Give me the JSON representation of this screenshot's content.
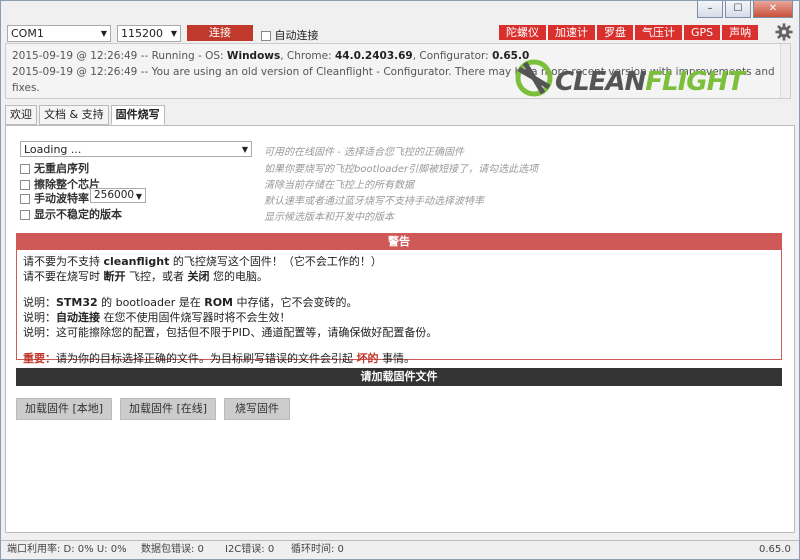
{
  "window_controls": {
    "minimize": "–",
    "maximize": "☐",
    "close": "✕"
  },
  "toolbar": {
    "port": "COM1",
    "baud": "115200",
    "connect_label": "连接",
    "auto_connect_label": "自动连接",
    "sensors": [
      "陀螺仪",
      "加速计",
      "罗盘",
      "气压计",
      "GPS",
      "声呐"
    ]
  },
  "log": {
    "line1": {
      "prefix": "2015-09-19 @ 12:26:49 -- Running - OS: ",
      "os": "Windows",
      "mid": ", Chrome: ",
      "chrome": "44.0.2403.69",
      "mid2": ", Configurator: ",
      "configurator": "0.65.0"
    },
    "line2": "2015-09-19 @ 12:26:49 -- You are using an old version of Cleanflight - Configurator. There may be a more recent version with improvements and fixes."
  },
  "logo": {
    "part1": "CLEAN",
    "part2": "FLIGHT"
  },
  "tabs": [
    "欢迎",
    "文档 & 支持",
    "固件烧写"
  ],
  "firmware": {
    "select_value": "Loading ...",
    "select_desc": "可用的在线固件 - 选择适合您飞控的正确固件",
    "options": [
      {
        "label": "无重启序列",
        "desc": "如果你要烧写的飞控bootloader引脚被短接了，请勾选此选项"
      },
      {
        "label": "擦除整个芯片",
        "desc": "清除当前存储在飞控上的所有数据"
      },
      {
        "label": "手动波特率",
        "desc": "默认速率或者通过蓝牙烧写不支持手动选择波特率"
      },
      {
        "label": "显示不稳定的版本",
        "desc": "显示候选版本和开发中的版本"
      }
    ],
    "baud_value": "256000"
  },
  "warning": {
    "title": "警告",
    "l1a": "请不要为不支持 ",
    "l1b": "cleanflight",
    "l1c": " 的飞控烧写这个固件！（它不会工作的！）",
    "l2a": "请不要在烧写时 ",
    "l2b": "断开",
    "l2c": " 飞控，或者 ",
    "l2d": "关闭",
    "l2e": " 您的电脑。",
    "n1a": "说明：",
    "n1b": "STM32",
    "n1c": " 的 bootloader 是在 ",
    "n1d": "ROM",
    "n1e": " 中存储，它不会变砖的。",
    "n2a": "说明：",
    "n2b": "自动连接",
    "n2c": " 在您不使用固件烧写器时将不会生效！",
    "n3": "说明：这可能擦除您的配置，包括但不限于PID、通道配置等，请确保做好配置备份。",
    "imp_a": "重要：",
    "imp_b": "请为你的目标选择正确的文件。为目标刷写错误的文件会引起 ",
    "imp_c": "坏的",
    "imp_d": " 事情。"
  },
  "load_header": "请加载固件文件",
  "buttons": {
    "local": "加载固件 [本地]",
    "online": "加载固件 [在线]",
    "flash": "烧写固件"
  },
  "status": {
    "port_usage": "端口利用率: D: 0% U: 0%",
    "packet_error": "数据包错误: 0",
    "i2c_error": "I2C错误: 0",
    "cycle_time": "循环时间: 0",
    "version": "0.65.0"
  }
}
